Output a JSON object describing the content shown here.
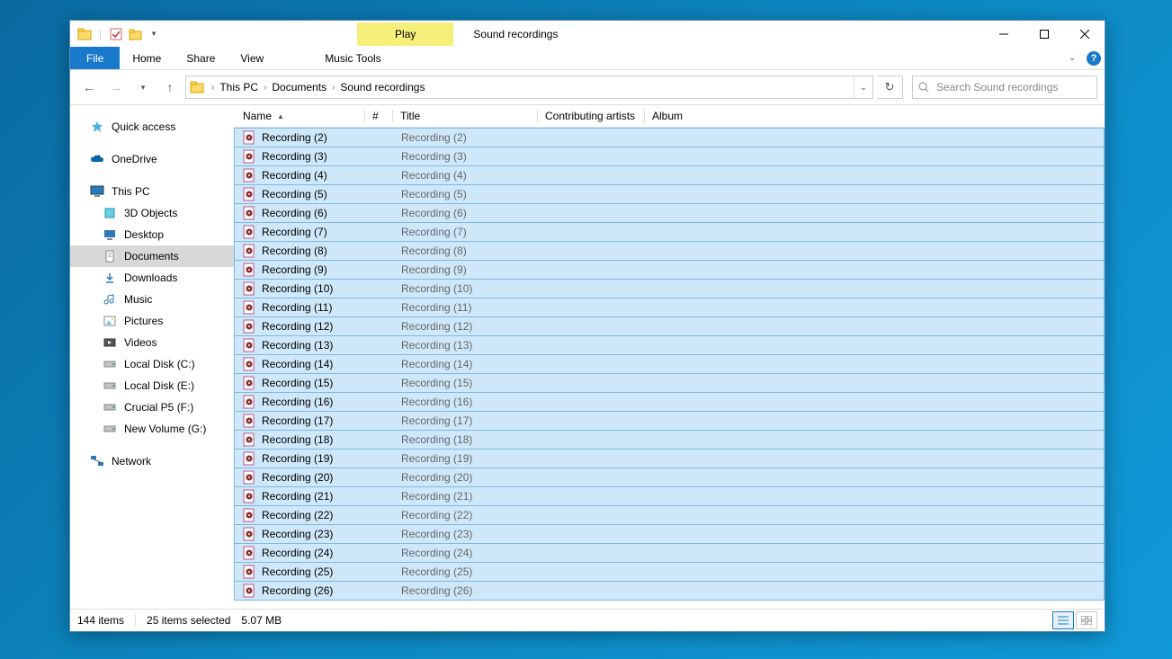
{
  "window": {
    "title": "Sound recordings",
    "contextual_tab": "Play"
  },
  "ribbon": {
    "file": "File",
    "home": "Home",
    "share": "Share",
    "view": "View",
    "music_tools": "Music Tools"
  },
  "breadcrumb": {
    "crumbs": [
      "This PC",
      "Documents",
      "Sound recordings"
    ]
  },
  "search": {
    "placeholder": "Search Sound recordings"
  },
  "nav": {
    "quick_access": "Quick access",
    "onedrive": "OneDrive",
    "this_pc": "This PC",
    "this_pc_children": [
      "3D Objects",
      "Desktop",
      "Documents",
      "Downloads",
      "Music",
      "Pictures",
      "Videos",
      "Local Disk (C:)",
      "Local Disk (E:)",
      "Crucial P5 (F:)",
      "New Volume (G:)"
    ],
    "network": "Network"
  },
  "columns": {
    "name": "Name",
    "number": "#",
    "title": "Title",
    "artists": "Contributing artists",
    "album": "Album"
  },
  "files": [
    {
      "name": "Recording (2)",
      "title": "Recording (2)"
    },
    {
      "name": "Recording (3)",
      "title": "Recording (3)"
    },
    {
      "name": "Recording (4)",
      "title": "Recording (4)"
    },
    {
      "name": "Recording (5)",
      "title": "Recording (5)"
    },
    {
      "name": "Recording (6)",
      "title": "Recording (6)"
    },
    {
      "name": "Recording (7)",
      "title": "Recording (7)"
    },
    {
      "name": "Recording (8)",
      "title": "Recording (8)"
    },
    {
      "name": "Recording (9)",
      "title": "Recording (9)"
    },
    {
      "name": "Recording (10)",
      "title": "Recording (10)"
    },
    {
      "name": "Recording (11)",
      "title": "Recording (11)"
    },
    {
      "name": "Recording (12)",
      "title": "Recording (12)"
    },
    {
      "name": "Recording (13)",
      "title": "Recording (13)"
    },
    {
      "name": "Recording (14)",
      "title": "Recording (14)"
    },
    {
      "name": "Recording (15)",
      "title": "Recording (15)"
    },
    {
      "name": "Recording (16)",
      "title": "Recording (16)"
    },
    {
      "name": "Recording (17)",
      "title": "Recording (17)"
    },
    {
      "name": "Recording (18)",
      "title": "Recording (18)"
    },
    {
      "name": "Recording (19)",
      "title": "Recording (19)"
    },
    {
      "name": "Recording (20)",
      "title": "Recording (20)"
    },
    {
      "name": "Recording (21)",
      "title": "Recording (21)"
    },
    {
      "name": "Recording (22)",
      "title": "Recording (22)"
    },
    {
      "name": "Recording (23)",
      "title": "Recording (23)"
    },
    {
      "name": "Recording (24)",
      "title": "Recording (24)"
    },
    {
      "name": "Recording (25)",
      "title": "Recording (25)"
    },
    {
      "name": "Recording (26)",
      "title": "Recording (26)"
    }
  ],
  "status": {
    "items": "144 items",
    "selected": "25 items selected",
    "size": "5.07 MB"
  }
}
